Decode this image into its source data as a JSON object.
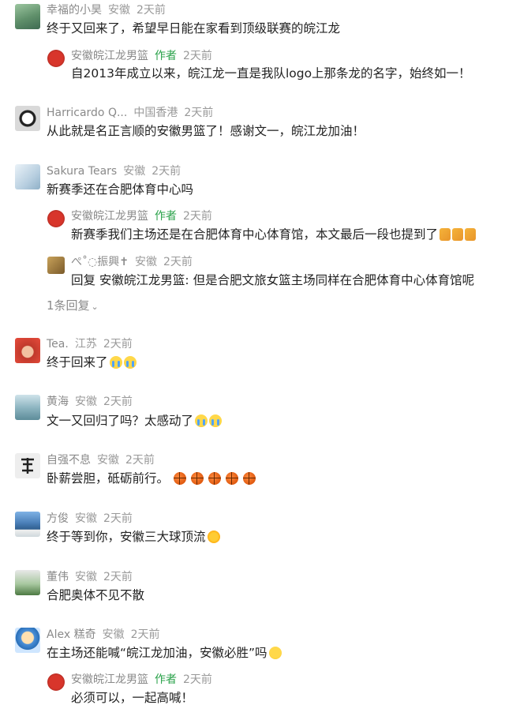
{
  "comments": [
    {
      "user": "幸福的小昊",
      "location": "安徽",
      "time": "2天前",
      "text": "终于又回来了，希望早日能在家看到顶级联赛的皖江龙",
      "reply": {
        "user": "安徽皖江龙男篮",
        "badge": "作者",
        "time": "2天前",
        "text": "自2013年成立以来，皖江龙一直是我队logo上那条龙的名字，始终如一！"
      }
    },
    {
      "user": "Harricardo Q...",
      "location": "中国香港",
      "time": "2天前",
      "text": "从此就是名正言顺的安徽男篮了！感谢文一，皖江龙加油！"
    },
    {
      "user": "Sakura Tears",
      "location": "安徽",
      "time": "2天前",
      "text": "新赛季还在合肥体育中心吗",
      "reply": {
        "user": "安徽皖江龙男篮",
        "badge": "作者",
        "time": "2天前",
        "text": "新赛季我们主场还是在合肥体育中心体育馆，本文最后一段也提到了"
      },
      "reply2": {
        "user": "ぺ˚◌振興✝",
        "location": "安徽",
        "time": "2天前",
        "text": "回复 安徽皖江龙男篮: 但是合肥文旅女篮主场同样在合肥体育中心体育馆呢"
      },
      "more": "1条回复"
    },
    {
      "user": "Tea.",
      "location": "江苏",
      "time": "2天前",
      "text": "终于回来了"
    },
    {
      "user": "黄海",
      "location": "安徽",
      "time": "2天前",
      "text": "文一又回归了吗？太感动了"
    },
    {
      "user": "自强不息",
      "location": "安徽",
      "time": "2天前",
      "text": "卧薪尝胆，砥砺前行。"
    },
    {
      "user": "方俊",
      "location": "安徽",
      "time": "2天前",
      "text": "终于等到你，安徽三大球顶流"
    },
    {
      "user": "董伟",
      "location": "安徽",
      "time": "2天前",
      "text": "合肥奥体不见不散"
    },
    {
      "user": "Alex 糕奇",
      "location": "安徽",
      "time": "2天前",
      "text": "在主场还能喊“皖江龙加油，安徽必胜”吗",
      "reply": {
        "user": "安徽皖江龙男篮",
        "badge": "作者",
        "time": "2天前",
        "text": "必须可以，一起高喊！"
      }
    }
  ]
}
